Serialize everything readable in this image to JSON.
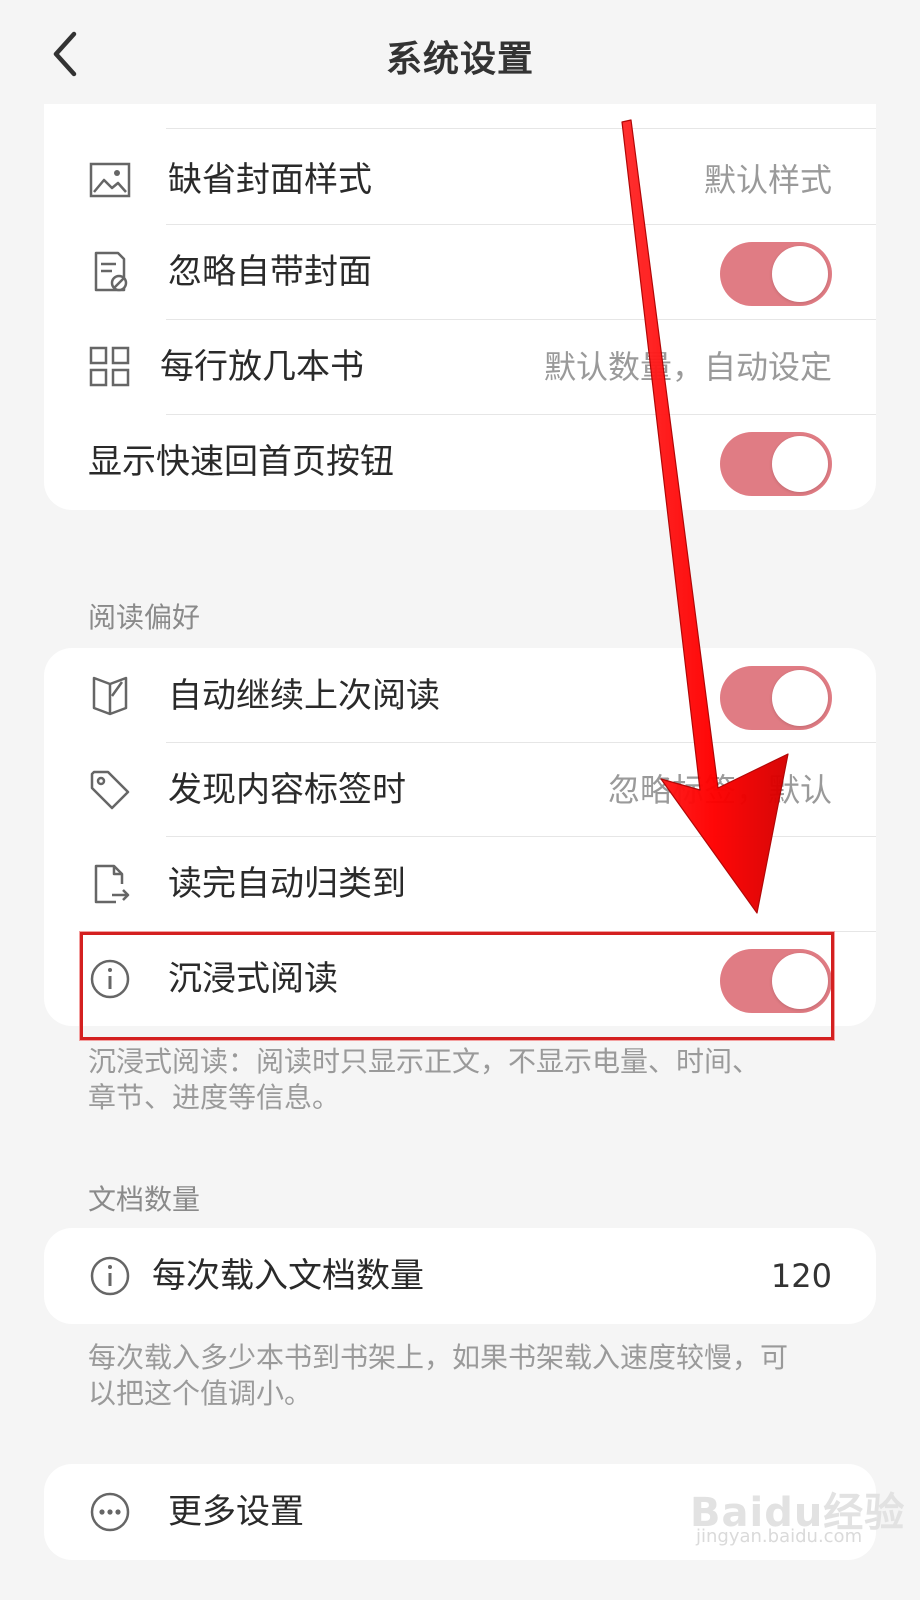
{
  "nav": {
    "title": "系统设置"
  },
  "display_section": {
    "rows": [
      {
        "label": "缺省封面样式",
        "value": "默认样式"
      },
      {
        "label": "忽略自带封面",
        "toggle_on": true
      },
      {
        "label": "每行放几本书",
        "value": "默认数量，自动设定"
      },
      {
        "label": "显示快速回首页按钮",
        "toggle_on": true
      }
    ]
  },
  "reading_section": {
    "header": "阅读偏好",
    "rows": [
      {
        "label": "自动继续上次阅读",
        "toggle_on": true
      },
      {
        "label": "发现内容标签时",
        "value": "忽略标签，默认"
      },
      {
        "label": "读完自动归类到"
      },
      {
        "label": "沉浸式阅读",
        "toggle_on": true
      }
    ],
    "footnote_line1": "沉浸式阅读：阅读时只显示正文，不显示电量、时间、",
    "footnote_line2": "章节、进度等信息。"
  },
  "document_section": {
    "header": "文档数量",
    "row": {
      "label": "每次载入文档数量",
      "value": "120"
    },
    "footnote_line1": "每次载入多少本书到书架上，如果书架载入速度较慢，可",
    "footnote_line2": "以把这个值调小。"
  },
  "more_section": {
    "row": {
      "label": "更多设置"
    }
  },
  "watermark": {
    "brand": "Baidu经验",
    "url": "jingyan.baidu.com"
  },
  "colors": {
    "toggle_on": "#e07c84",
    "annotation_red": "#ff0000",
    "highlight_border": "#d42020"
  }
}
